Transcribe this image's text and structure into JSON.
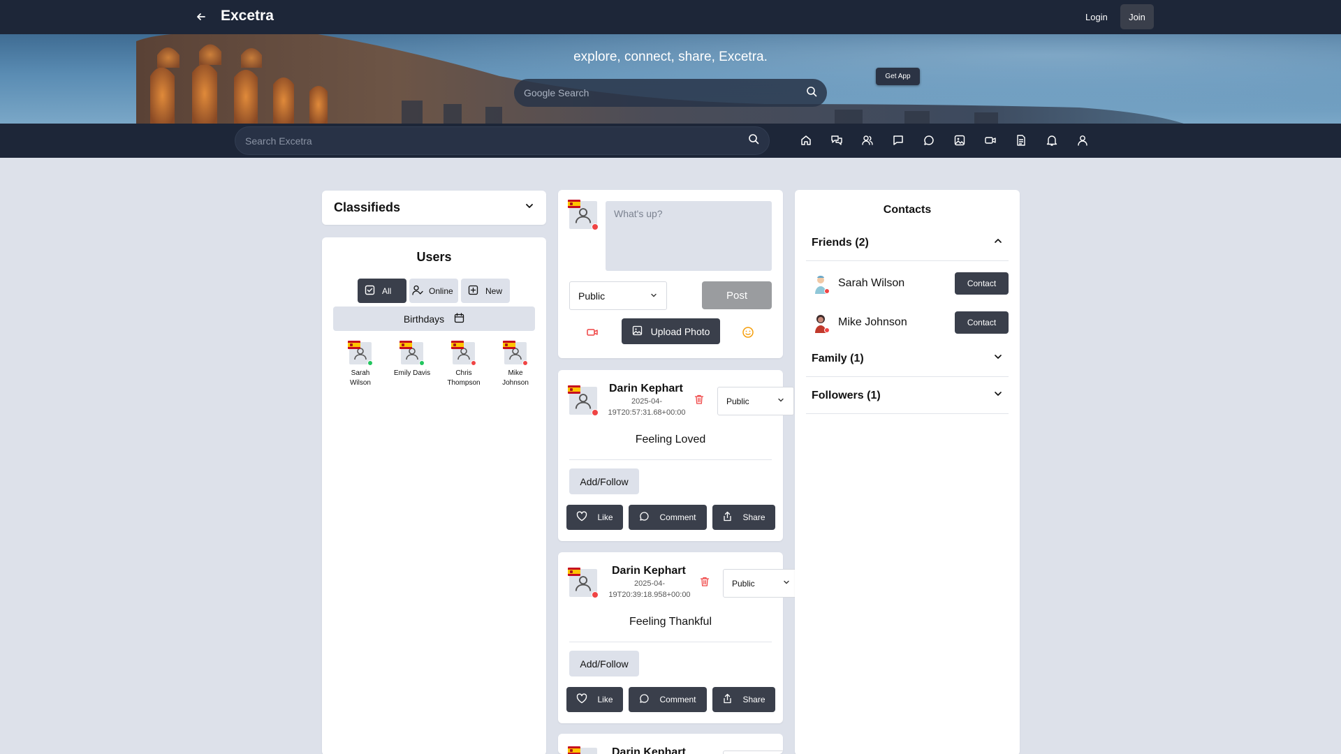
{
  "header": {
    "brand": "Excetra",
    "login_label": "Login",
    "join_label": "Join"
  },
  "hero": {
    "tagline": "explore, connect, share, Excetra.",
    "google_search_placeholder": "Google Search",
    "get_app_label": "Get App"
  },
  "nav": {
    "search_placeholder": "Search Excetra",
    "icons": [
      "home-icon",
      "messages-icon",
      "users-icon",
      "chat-icon",
      "comment-icon",
      "image-icon",
      "video-icon",
      "document-icon",
      "bell-icon",
      "profile-icon"
    ]
  },
  "classifieds": {
    "title": "Classifieds"
  },
  "users": {
    "title": "Users",
    "filters": [
      {
        "label": "All",
        "icon": "check-square-icon",
        "active": true
      },
      {
        "label": "Online",
        "icon": "user-check-icon",
        "active": false
      },
      {
        "label": "New",
        "icon": "plus-square-icon",
        "active": false
      }
    ],
    "birthdays_label": "Birthdays",
    "list": [
      {
        "name": "Sarah Wilson",
        "status": "online"
      },
      {
        "name": "Emily Davis",
        "status": "online"
      },
      {
        "name": "Chris Thompson",
        "status": "offline"
      },
      {
        "name": "Mike Johnson",
        "status": "offline"
      }
    ]
  },
  "composer": {
    "placeholder": "What's up?",
    "visibility": "Public",
    "post_label": "Post",
    "upload_label": "Upload Photo"
  },
  "posts": [
    {
      "author": "Darin Kephart",
      "time_line1": "2025-04-",
      "time_line2": "19T20:57:31.68+00:00",
      "visibility": "Public",
      "feeling": "Feeling Loved",
      "follow_label": "Add/Follow",
      "like_label": "Like",
      "comment_label": "Comment",
      "share_label": "Share"
    },
    {
      "author": "Darin Kephart",
      "time_line1": "2025-04-",
      "time_line2": "19T20:39:18.958+00:00",
      "visibility": "Public",
      "feeling": "Feeling Thankful",
      "follow_label": "Add/Follow",
      "like_label": "Like",
      "comment_label": "Comment",
      "share_label": "Share"
    },
    {
      "author": "Darin Kephart"
    }
  ],
  "contacts": {
    "title": "Contacts",
    "friends_label": "Friends (2)",
    "friends": [
      {
        "name": "Sarah Wilson",
        "button": "Contact"
      },
      {
        "name": "Mike Johnson",
        "button": "Contact"
      }
    ],
    "family_label": "Family (1)",
    "followers_label": "Followers (1)"
  },
  "colors": {
    "header_bg": "#1d2638",
    "page_bg": "#dde1ea",
    "dark_button": "#3a3f4b",
    "online": "#22c55e",
    "offline": "#ef4444",
    "trash": "#ef4444",
    "emoji": "#f59e0b"
  }
}
